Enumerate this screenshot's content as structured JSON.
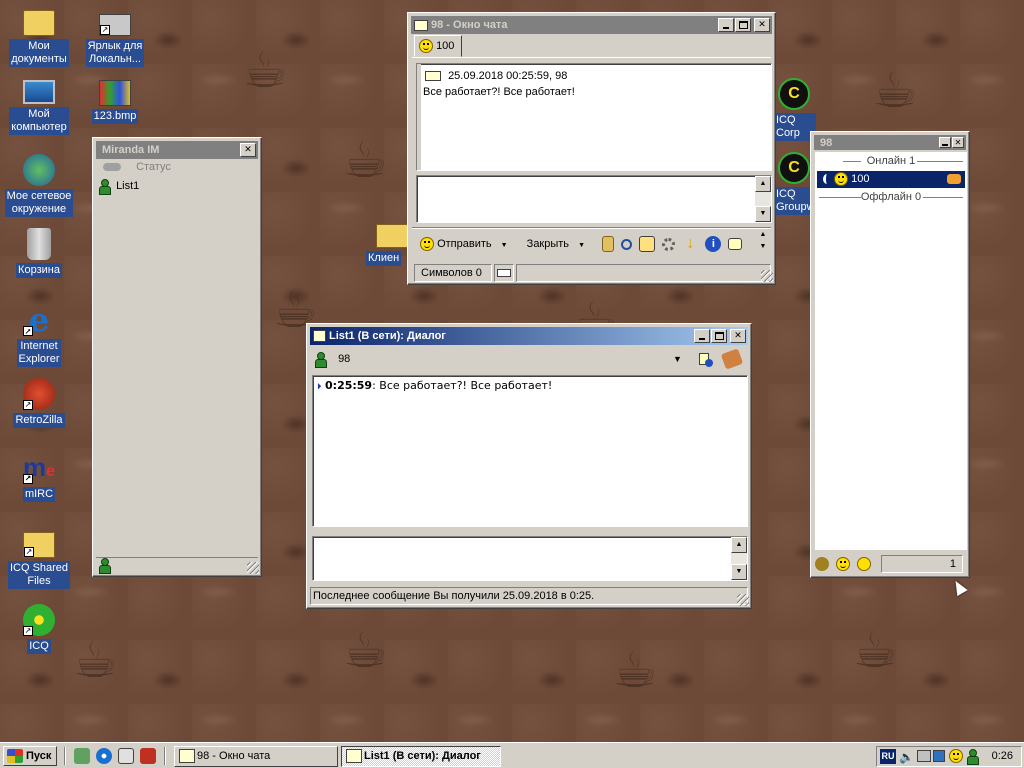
{
  "desktop_icons": [
    {
      "label": "Мои\nдокументы",
      "icon": "folder-documents-icon"
    },
    {
      "label": "Ярлык для\nЛокальн...",
      "icon": "shortcut-icon"
    },
    {
      "label": "Мой\nкомпьютер",
      "icon": "computer-icon"
    },
    {
      "label": "123.bmp",
      "icon": "bitmap-icon"
    },
    {
      "label": "Мое сетевое\nокружение",
      "icon": "network-icon"
    },
    {
      "label": "Корзина",
      "icon": "recycle-bin-icon"
    },
    {
      "label": "Internet\nExplorer",
      "icon": "ie-icon"
    },
    {
      "label": "RetroZilla",
      "icon": "retrozilla-icon"
    },
    {
      "label": "mIRC",
      "icon": "mirc-icon"
    },
    {
      "label": "ICQ Shared\nFiles",
      "icon": "icq-folder-icon"
    },
    {
      "label": "ICQ",
      "icon": "icq-icon"
    },
    {
      "label": "Клиен",
      "icon": "folder-icon"
    },
    {
      "label": "ICQ Corp",
      "icon": "icq-corp-icon"
    },
    {
      "label": "ICQ\nGroupw...",
      "icon": "icq-groupware-icon"
    }
  ],
  "miranda": {
    "title": "Miranda IM",
    "status_label": "Статус",
    "contact": "List1"
  },
  "chat_window": {
    "title": "98  - Окно чата",
    "tab": "100",
    "message_header": "25.09.2018 00:25:59, 98",
    "message_text": "Все работает?! Все работает!",
    "send_label": "Отправить",
    "close_label": "Закрыть",
    "status_chars": "Символов 0"
  },
  "contact_list": {
    "title": "98",
    "online_group": "Онлайн 1",
    "contact": "100",
    "offline_group": "Оффлайн 0",
    "footer_count": "1"
  },
  "dialog": {
    "title": "List1 (В сети): Диалог",
    "contact": "98",
    "msg_time": "0:25:59",
    "msg_text": ": Все работает?! Все работает!",
    "status": "Последнее сообщение Вы получили 25.09.2018 в 0:25."
  },
  "taskbar": {
    "start_label": "Пуск",
    "tasks": [
      {
        "label": "98  - Окно чата",
        "active": false
      },
      {
        "label": "List1 (В сети): Диалог",
        "active": true
      }
    ],
    "lang": "RU",
    "clock": "0:26"
  },
  "colors": {
    "title_active": "#0a246a",
    "title_inactive": "#808080",
    "selection": "#0a246a",
    "desktop": "#6d4a38"
  }
}
